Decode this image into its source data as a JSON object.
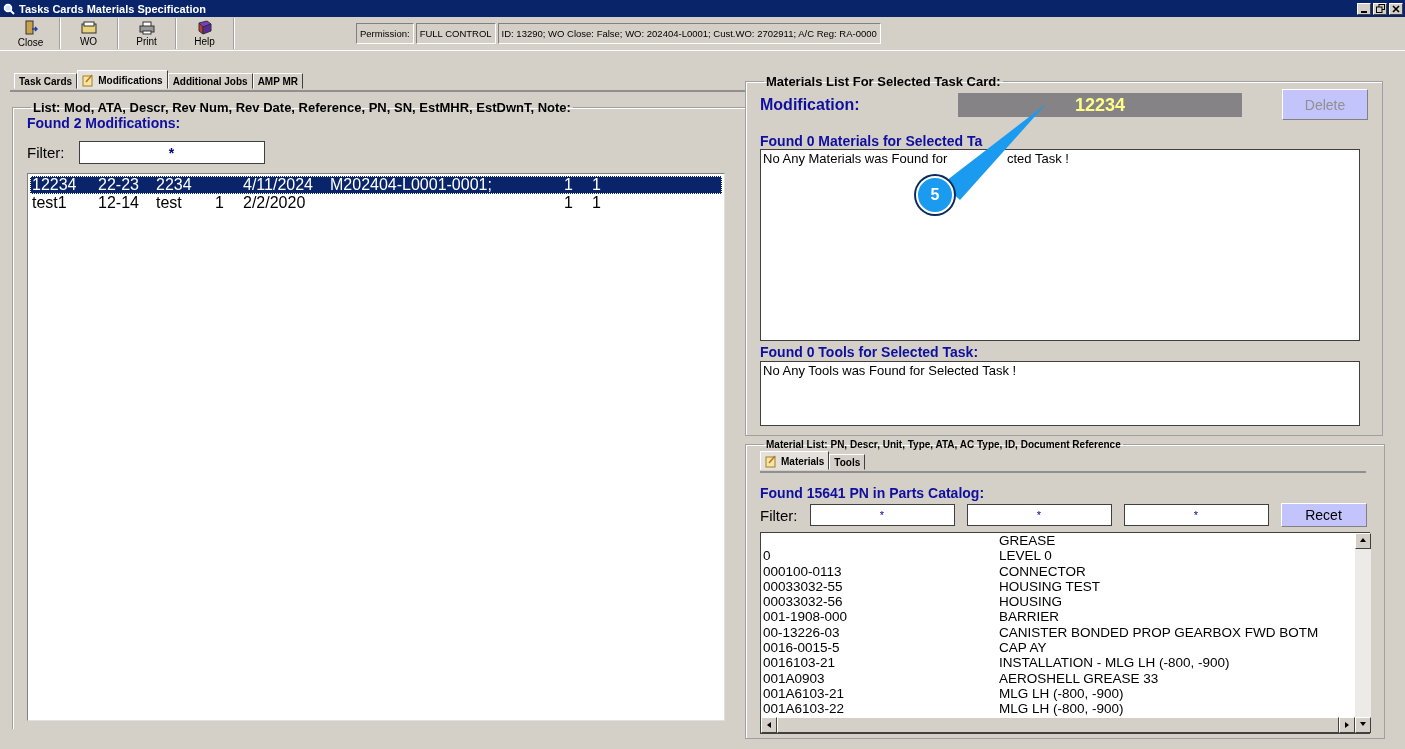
{
  "window": {
    "title": "Tasks Cards Materials Specification",
    "controls": [
      {
        "kind": "minimize"
      },
      {
        "kind": "restore"
      },
      {
        "kind": "close"
      }
    ]
  },
  "toolbar": {
    "buttons": [
      {
        "label": "Close",
        "kind": "exit"
      },
      {
        "label": "WO",
        "kind": "wo"
      },
      {
        "label": "Print",
        "kind": "print"
      },
      {
        "label": "Help",
        "kind": "help"
      }
    ],
    "permission_label": "Permission:",
    "permission_value": "FULL CONTROL",
    "info": "ID: 13290; WO Close: False; WO: 202404-L0001; Cust.WO: 2702911; A/C Reg: RA-0000"
  },
  "tabs": [
    {
      "label": "Task Cards",
      "selected": false,
      "icon": false
    },
    {
      "label": "Modifications",
      "selected": true,
      "icon": true
    },
    {
      "label": "Additional Jobs",
      "selected": false,
      "icon": false
    },
    {
      "label": "AMP MR",
      "selected": false,
      "icon": false
    }
  ],
  "modifications": {
    "group_title": "List: Mod, ATA, Descr, Rev Num, Rev Date, Reference, PN, SN, EstMHR, EstDwnT, Note:",
    "found": "Found 2 Modifications:",
    "filter_label": "Filter:",
    "filter_value": "*",
    "rows": [
      {
        "selected": true,
        "cells": [
          "12234",
          "22-23",
          "2234",
          "",
          "4/11/2024",
          "M202404-L0001-0001;",
          "1",
          "1"
        ]
      },
      {
        "selected": false,
        "cells": [
          "test1",
          "12-14",
          "test",
          "1",
          "2/2/2020",
          "",
          "1",
          "1"
        ]
      }
    ]
  },
  "materials_panel": {
    "group_title": "Materials List For Selected Task Card:",
    "modification_label": "Modification:",
    "modification_value": "12234",
    "delete_button": {
      "label": "Delete",
      "disabled": true
    },
    "materials_label": "Found 0 Materials for Selected Ta",
    "materials_message": [
      "No Any Materials was Found for",
      "cted Task !"
    ],
    "tools_label": "Found 0 Tools for Selected Task:",
    "tools_message": "No Any Tools was Found for Selected Task !"
  },
  "callout": {
    "label": "5"
  },
  "catalog": {
    "group_title": "Material List: PN, Descr, Unit, Type, ATA, AC Type, ID, Document Reference",
    "tabs": [
      {
        "label": "Materials",
        "selected": true,
        "icon": true
      },
      {
        "label": "Tools",
        "selected": false,
        "icon": false
      }
    ],
    "found": "Found 15641 PN in Parts Catalog:",
    "filter_label": "Filter:",
    "filters": [
      "*",
      "*",
      "*"
    ],
    "reset_button": "Recet",
    "rows": [
      {
        "pn": "",
        "descr": "GREASE"
      },
      {
        "pn": "0",
        "descr": "LEVEL 0"
      },
      {
        "pn": "000100-0113",
        "descr": "CONNECTOR"
      },
      {
        "pn": "00033032-55",
        "descr": "HOUSING TEST"
      },
      {
        "pn": "00033032-56",
        "descr": "HOUSING"
      },
      {
        "pn": "001-1908-000",
        "descr": "BARRIER"
      },
      {
        "pn": "00-13226-03",
        "descr": "CANISTER BONDED PROP GEARBOX FWD BOTM"
      },
      {
        "pn": "0016-0015-5",
        "descr": "CAP AY"
      },
      {
        "pn": "0016103-21",
        "descr": "INSTALLATION - MLG LH (-800, -900)"
      },
      {
        "pn": "001A0903",
        "descr": "AEROSHELL GREASE 33"
      },
      {
        "pn": "001A6103-21",
        "descr": "MLG LH (-800, -900)"
      },
      {
        "pn": "001A6103-22",
        "descr": "MLG LH (-800, -900)"
      }
    ]
  }
}
